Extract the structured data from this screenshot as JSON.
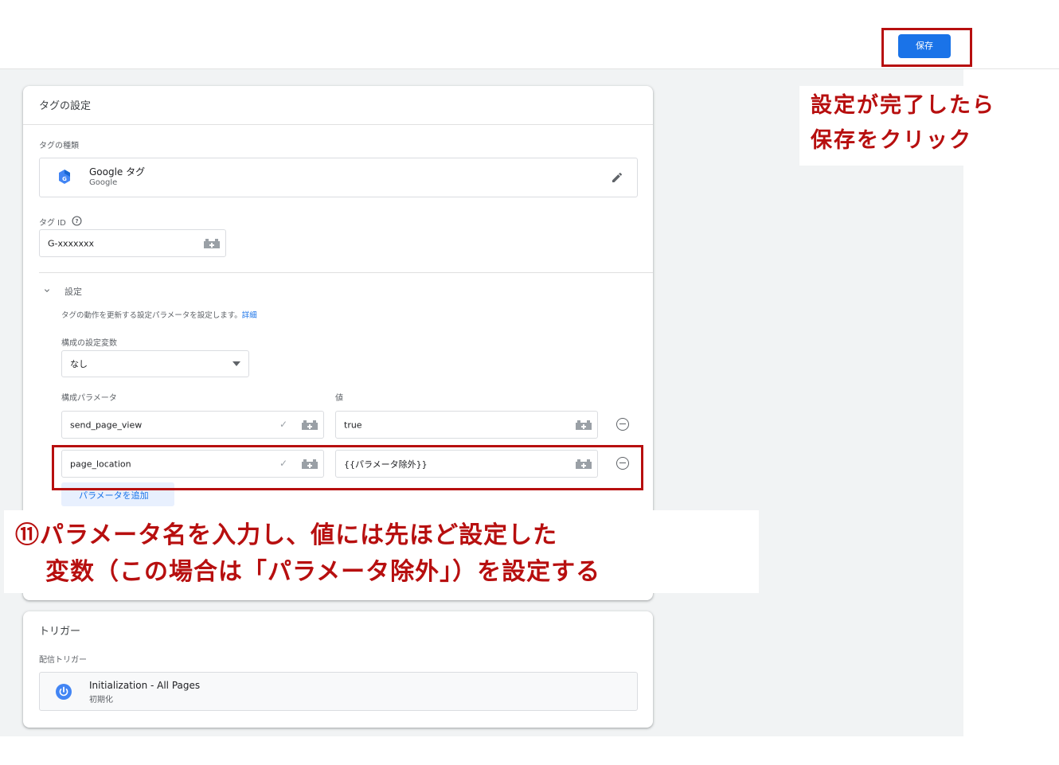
{
  "header": {
    "save_label": "保存"
  },
  "annotations": {
    "save_note_line1": "設定が完了したら",
    "save_note_line2": "保存をクリック",
    "param_note_line1": "⑪パラメータ名を入力し、値には先ほど設定した",
    "param_note_line2": "変数（この場合は「パラメータ除外」）を設定する",
    "accent_color": "#b70f0f"
  },
  "tag_config": {
    "title": "タグの設定",
    "tag_type_label": "タグの種類",
    "tag_type_name": "Google タグ",
    "tag_type_sub": "Google",
    "tag_id_label": "タグ ID",
    "tag_id_value": "G-xxxxxxx",
    "settings_section": {
      "title": "設定",
      "description": "タグの動作を更新する設定パラメータを設定します。",
      "link": "詳細",
      "config_var_label": "構成の設定変数",
      "config_var_value": "なし",
      "param_col_label": "構成パラメータ",
      "value_col_label": "値",
      "rows": [
        {
          "param": "send_page_view",
          "value": "true"
        },
        {
          "param": "page_location",
          "value": "{{パラメータ除外}}"
        }
      ],
      "add_param_label": "パラメータを追加"
    }
  },
  "trigger": {
    "title": "トリガー",
    "firing_label": "配信トリガー",
    "name": "Initialization - All Pages",
    "sub": "初期化",
    "icon": "power-icon"
  },
  "colors": {
    "primary": "#1a73e8",
    "accent": "#b70f0f"
  }
}
